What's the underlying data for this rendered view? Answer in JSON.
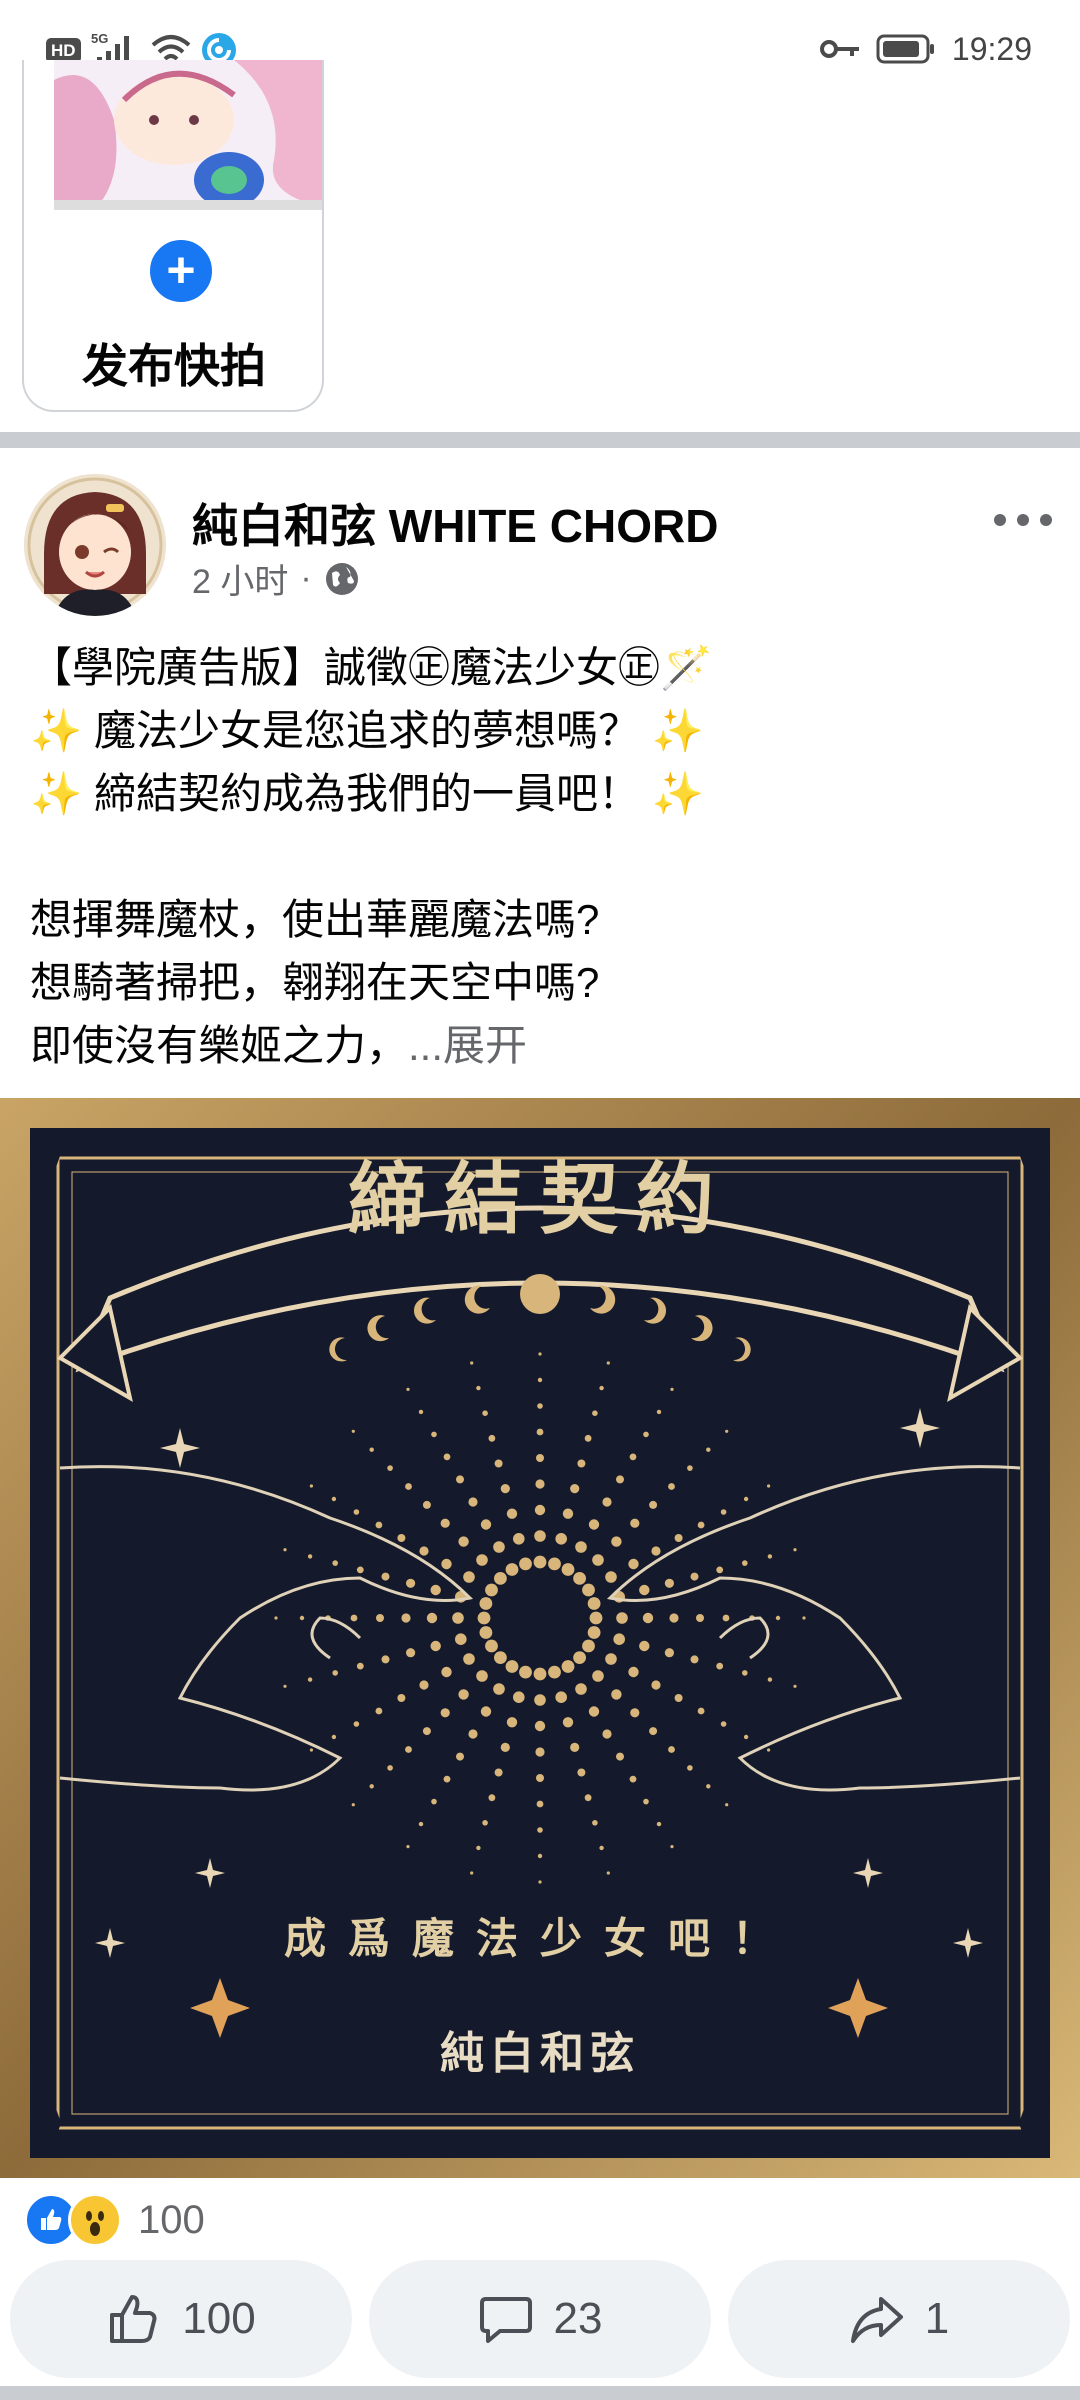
{
  "status_bar": {
    "hd_label": "HD",
    "network_label": "5G",
    "time": "19:29"
  },
  "story": {
    "create_label": "发布快拍"
  },
  "post": {
    "page_name": "純白和弦 WHITE CHORD",
    "time_ago": "2 小时",
    "separator": "·",
    "text_lines": [
      "【學院廣告版】誠徵㊣魔法少女㊣🪄",
      "✨ 魔法少女是您追求的夢想嗎？ ✨",
      "✨ 締結契約成為我們的一員吧！ ✨",
      "",
      "想揮舞魔杖，使出華麗魔法嗎?",
      "想騎著掃把，翱翔在天空中嗎?",
      "即使沒有樂姬之力，"
    ],
    "see_more": "...展开",
    "image": {
      "title": "締結契約",
      "subtitle": "成爲魔法少女吧！",
      "logo": "純白和弦"
    },
    "reactions_count": "100",
    "actions": {
      "like_count": "100",
      "comment_count": "23",
      "share_count": "1"
    }
  },
  "colors": {
    "accent": "#1877f2",
    "secondary_text": "#65676b",
    "button_bg": "#eff2f5",
    "poster_bg": "#141a2c",
    "poster_gold": "#d8b57a"
  }
}
